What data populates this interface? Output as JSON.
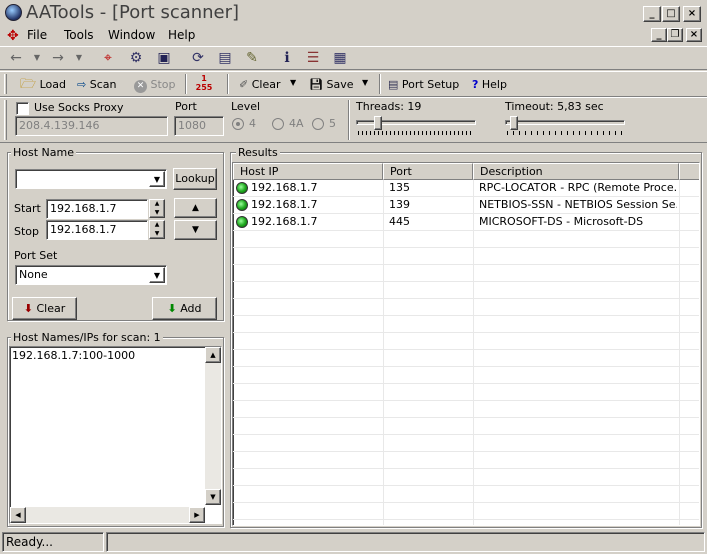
{
  "window": {
    "title": "AATools - [Port scanner]",
    "app_icon": "globe-icon"
  },
  "menu": {
    "items": [
      "File",
      "Tools",
      "Window",
      "Help"
    ]
  },
  "toolbar2": {
    "load": "Load",
    "scan": "Scan",
    "stop": "Stop",
    "clear": "Clear",
    "save": "Save",
    "port_setup": "Port Setup",
    "help": "Help",
    "range_top": "1",
    "range_bottom": "255"
  },
  "settings": {
    "socks_label": "Use Socks Proxy",
    "socks_ip": "208.4.139.146",
    "port_label": "Port",
    "port_value": "1080",
    "level_label": "Level",
    "level_opts": [
      "4",
      "4A",
      "5"
    ],
    "threads_label": "Threads: 19",
    "timeout_label": "Timeout: 5,83 sec"
  },
  "hostpanel": {
    "group": "Host Name",
    "hostname": "",
    "lookup": "Lookup",
    "start_label": "Start",
    "start_value": "192.168.1.7",
    "stop_label": "Stop",
    "stop_value": "192.168.1.7",
    "portset_label": "Port Set",
    "portset_value": "None",
    "clear": "Clear",
    "add": "Add",
    "list_title": "Host Names/IPs for scan: 1",
    "list_item": "192.168.1.7:100-1000"
  },
  "results": {
    "group": "Results",
    "columns": [
      "Host IP",
      "Port",
      "Description"
    ],
    "rows": [
      {
        "ip": "192.168.1.7",
        "port": "135",
        "desc": "RPC-LOCATOR - RPC (Remote Proce..."
      },
      {
        "ip": "192.168.1.7",
        "port": "139",
        "desc": "NETBIOS-SSN - NETBIOS Session Se..."
      },
      {
        "ip": "192.168.1.7",
        "port": "445",
        "desc": "MICROSOFT-DS - Microsoft-DS"
      }
    ]
  },
  "status": {
    "text": "Ready..."
  }
}
